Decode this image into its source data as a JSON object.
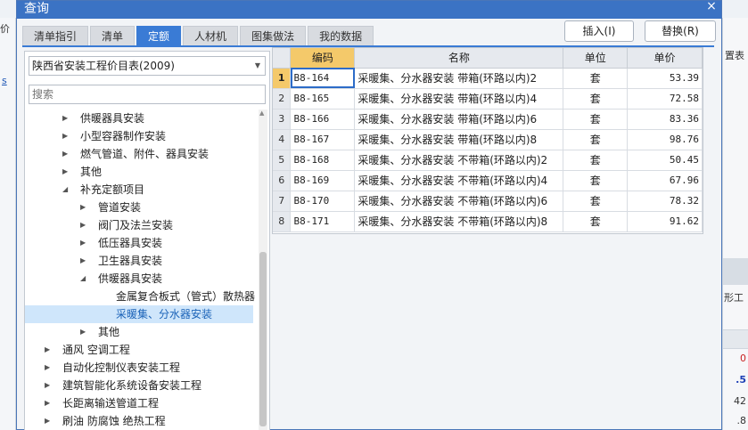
{
  "background": {
    "left_label": "价",
    "left_link": "s",
    "right_cells": [
      "置表",
      "形工",
      "0",
      ".5",
      "42",
      ".8"
    ]
  },
  "dialog": {
    "title": "查询",
    "close_glyph": "×"
  },
  "tabs": [
    {
      "label": "清单指引",
      "active": false
    },
    {
      "label": "清单",
      "active": false
    },
    {
      "label": "定额",
      "active": true
    },
    {
      "label": "人材机",
      "active": false
    },
    {
      "label": "图集做法",
      "active": false
    },
    {
      "label": "我的数据",
      "active": false
    }
  ],
  "actions": {
    "insert_label": "插入(I)",
    "replace_label": "替换(R)"
  },
  "left": {
    "library_select": "陕西省安装工程价目表(2009)",
    "search_placeholder": "搜索",
    "tree": [
      {
        "label": "供暖器具安装",
        "level": 1,
        "state": "collapsed"
      },
      {
        "label": "小型容器制作安装",
        "level": 1,
        "state": "collapsed"
      },
      {
        "label": "燃气管道、附件、器具安装",
        "level": 1,
        "state": "collapsed"
      },
      {
        "label": "其他",
        "level": 1,
        "state": "collapsed"
      },
      {
        "label": "补充定额项目",
        "level": 1,
        "state": "expanded"
      },
      {
        "label": "管道安装",
        "level": 2,
        "state": "collapsed"
      },
      {
        "label": "阀门及法兰安装",
        "level": 2,
        "state": "collapsed"
      },
      {
        "label": "低压器具安装",
        "level": 2,
        "state": "collapsed"
      },
      {
        "label": "卫生器具安装",
        "level": 2,
        "state": "collapsed"
      },
      {
        "label": "供暖器具安装",
        "level": 2,
        "state": "expanded"
      },
      {
        "label": "金属复合板式（管式）散热器",
        "level": 3,
        "state": "leaf"
      },
      {
        "label": "采暖集、分水器安装",
        "level": 3,
        "state": "leaf",
        "selected": true
      },
      {
        "label": "其他",
        "level": 2,
        "state": "collapsed"
      },
      {
        "label": "通风 空调工程",
        "level": 0,
        "state": "collapsed"
      },
      {
        "label": "自动化控制仪表安装工程",
        "level": 0,
        "state": "collapsed"
      },
      {
        "label": "建筑智能化系统设备安装工程",
        "level": 0,
        "state": "collapsed"
      },
      {
        "label": "长距离输送管道工程",
        "level": 0,
        "state": "collapsed"
      },
      {
        "label": "刷油 防腐蚀 绝热工程",
        "level": 0,
        "state": "collapsed"
      }
    ]
  },
  "grid": {
    "columns": [
      "编码",
      "名称",
      "单位",
      "单价"
    ],
    "rows": [
      {
        "no": "1",
        "code": "B8-164",
        "name": "采暖集、分水器安装 带箱(环路以内)2",
        "unit": "套",
        "price": "53.39"
      },
      {
        "no": "2",
        "code": "B8-165",
        "name": "采暖集、分水器安装 带箱(环路以内)4",
        "unit": "套",
        "price": "72.58"
      },
      {
        "no": "3",
        "code": "B8-166",
        "name": "采暖集、分水器安装 带箱(环路以内)6",
        "unit": "套",
        "price": "83.36"
      },
      {
        "no": "4",
        "code": "B8-167",
        "name": "采暖集、分水器安装 带箱(环路以内)8",
        "unit": "套",
        "price": "98.76"
      },
      {
        "no": "5",
        "code": "B8-168",
        "name": "采暖集、分水器安装 不带箱(环路以内)2",
        "unit": "套",
        "price": "50.45"
      },
      {
        "no": "6",
        "code": "B8-169",
        "name": "采暖集、分水器安装 不带箱(环路以内)4",
        "unit": "套",
        "price": "67.96"
      },
      {
        "no": "7",
        "code": "B8-170",
        "name": "采暖集、分水器安装 不带箱(环路以内)6",
        "unit": "套",
        "price": "78.32"
      },
      {
        "no": "8",
        "code": "B8-171",
        "name": "采暖集、分水器安装 不带箱(环路以内)8",
        "unit": "套",
        "price": "91.62"
      }
    ]
  },
  "colors": {
    "accent": "#3a7bd5",
    "title_bar": "#3b73c4",
    "header_highlight": "#f4c96a",
    "tree_selected_bg": "#cfe6fb"
  }
}
